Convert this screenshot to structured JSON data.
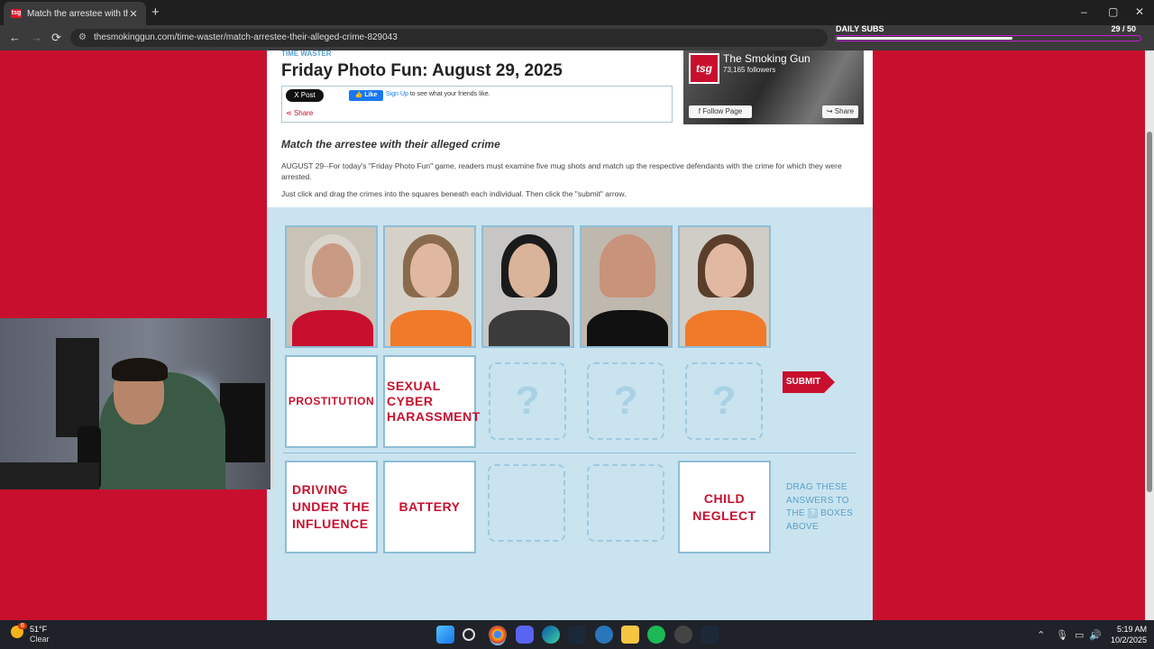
{
  "browser": {
    "tab_title": "Match the arrestee with their alleged crime",
    "tab_close": "✕",
    "new_tab": "+",
    "url": "thesmokinggun.com/time-waster/match-arrestee-their-alleged-crime-829043",
    "window_controls": [
      "–",
      "▢",
      "✕"
    ]
  },
  "stream_overlay": {
    "label": "DAILY SUBS",
    "count": "29",
    "goal": "/ 50",
    "progress": 0.58
  },
  "article": {
    "kicker": "TIME WASTER",
    "title": "Friday Photo Fun: August 29, 2025",
    "x_post": "X Post",
    "fb_like": "Like",
    "fb_signup": "Sign Up",
    "fb_text": "to see what your friends like.",
    "share": "Share",
    "subtitle": "Match the arrestee with their alleged crime",
    "para1": "AUGUST 29--For today's \"Friday Photo Fun\" game, readers must examine five mug shots and match up the respective defendants with the crime for which they were arrested.",
    "para2": "Just click and drag the crimes into the squares beneath each individual. Then click the \"submit\" arrow."
  },
  "fb_widget": {
    "logo": "tsg",
    "page_name": "The Smoking Gun",
    "followers": "73,165 followers",
    "follow_btn": "Follow Page",
    "share_btn": "Share"
  },
  "game": {
    "mugshots": [
      {
        "name": "mugshot-1",
        "bg": "#c9c2b6",
        "skin": "#c89a84",
        "hair": "#d9d4cc",
        "shirt": "#c8102e"
      },
      {
        "name": "mugshot-2",
        "bg": "#d6d1c8",
        "skin": "#e0b7a0",
        "hair": "#8a6a4c",
        "shirt": "#f07a2a"
      },
      {
        "name": "mugshot-3",
        "bg": "#c8c6c4",
        "skin": "#d9b39a",
        "hair": "#1a1a1a",
        "shirt": "#3b3b3b"
      },
      {
        "name": "mugshot-4",
        "bg": "#bfb8ae",
        "skin": "#c9927a",
        "hair": "#c9927a",
        "shirt": "#111111"
      },
      {
        "name": "mugshot-5",
        "bg": "#cfcdc6",
        "skin": "#e1b9a3",
        "hair": "#5a3e2b",
        "shirt": "#f07a2a"
      }
    ],
    "placed_answers": [
      "PROSTITUTION",
      "SEXUAL CYBER HARASSMENT"
    ],
    "empty_slot_mark": "?",
    "submit_label": "SUBMIT",
    "answer_bank": [
      "DRIVING UNDER THE INFLUENCE",
      "BATTERY",
      "",
      "",
      "CHILD NEGLECT"
    ],
    "hint_pre": "DRAG THESE ANSWERS TO THE",
    "hint_icon": "?",
    "hint_post": "BOXES ABOVE"
  },
  "taskbar": {
    "temp": "51°F",
    "condition": "Clear",
    "weather_badge": "6",
    "time": "5:19 AM",
    "date": "10/2/2025",
    "apps": [
      "windows-start",
      "search",
      "chrome",
      "discord",
      "edge",
      "steam",
      "epic",
      "files",
      "spotify",
      "obs",
      "steam-2"
    ]
  }
}
